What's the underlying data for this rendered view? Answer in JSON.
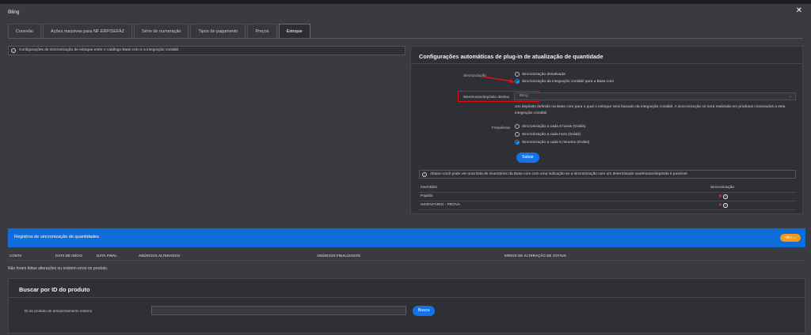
{
  "window": {
    "title": "Bling",
    "close_icon": "close-icon"
  },
  "tabs": [
    {
      "label": "Conexão",
      "active": false
    },
    {
      "label": "Ações massivas para NF ERP/SEFAZ",
      "active": false
    },
    {
      "label": "Série de numeração",
      "active": false
    },
    {
      "label": "Tipos de pagamento",
      "active": false
    },
    {
      "label": "Preços",
      "active": false
    },
    {
      "label": "Estoque",
      "active": true
    }
  ],
  "info_text": "Configurações de sincronização de estoque entre o catálogo Base.com e a integração contábil.",
  "auto_config": {
    "title": "Configurações automáticas de plug-in de atualização de quantidade",
    "sync_label": "Sincronização",
    "sync_options": [
      {
        "label": "Sincronização desativada",
        "selected": false
      },
      {
        "label": "Sincronização da integração contábil para a Base.com",
        "selected": true
      }
    ],
    "warehouse_label": "Warehouse/depósito destino",
    "warehouse_value": "Bling",
    "warehouse_description": "Um depósito definido na Base.com para o qual o estoque será baixado da integração contábil. A sincronização só será realizada em produtos conectados a esta integração contábil.",
    "frequency_label": "Frequência",
    "frequency_options": [
      {
        "label": "Sincronização a cada 8 horas (Grátis)",
        "selected": false
      },
      {
        "label": "Sincronização a cada hora (Grátis)",
        "selected": false
      },
      {
        "label": "Sincronização a cada 5 minutos (Grátis)",
        "selected": true
      }
    ],
    "save_label": "Salvar",
    "inventory_info": "Abaixo você pode ver uma lista de inventários da Base.com com uma indicação se a sincronização com um determinado warehouse/depósito é possível.",
    "inventory_headers": {
      "inventory": "Inventário",
      "sync": "Sincronização"
    },
    "inventory_rows": [
      {
        "name": "Padrão"
      },
      {
        "name": "INVENTÁRIO - PROVA"
      }
    ]
  },
  "logs": {
    "title": "Registros de sincronização de quantidades",
    "filter_label": "Filtro",
    "headers": [
      "CONTA",
      "DATA DE INÍCIO",
      "DATA FINAL",
      "ANÚNCIOS ALTERADOS",
      "ANÚNCIOS FINALIZADOS",
      "ERROS DE ALTERAÇÃO DE STATUS"
    ],
    "empty_text": "Não foram feitas alterações ou existem erros no produto."
  },
  "search": {
    "title": "Buscar por ID do produto",
    "field_label": "ID do produto de armazenamento externo",
    "field_value": "",
    "button_label": "Busca"
  },
  "colors": {
    "accent": "#1473e6",
    "highlight": "#e10e12",
    "filter_pill": "#f29a1b",
    "background": "#3a3b40"
  }
}
